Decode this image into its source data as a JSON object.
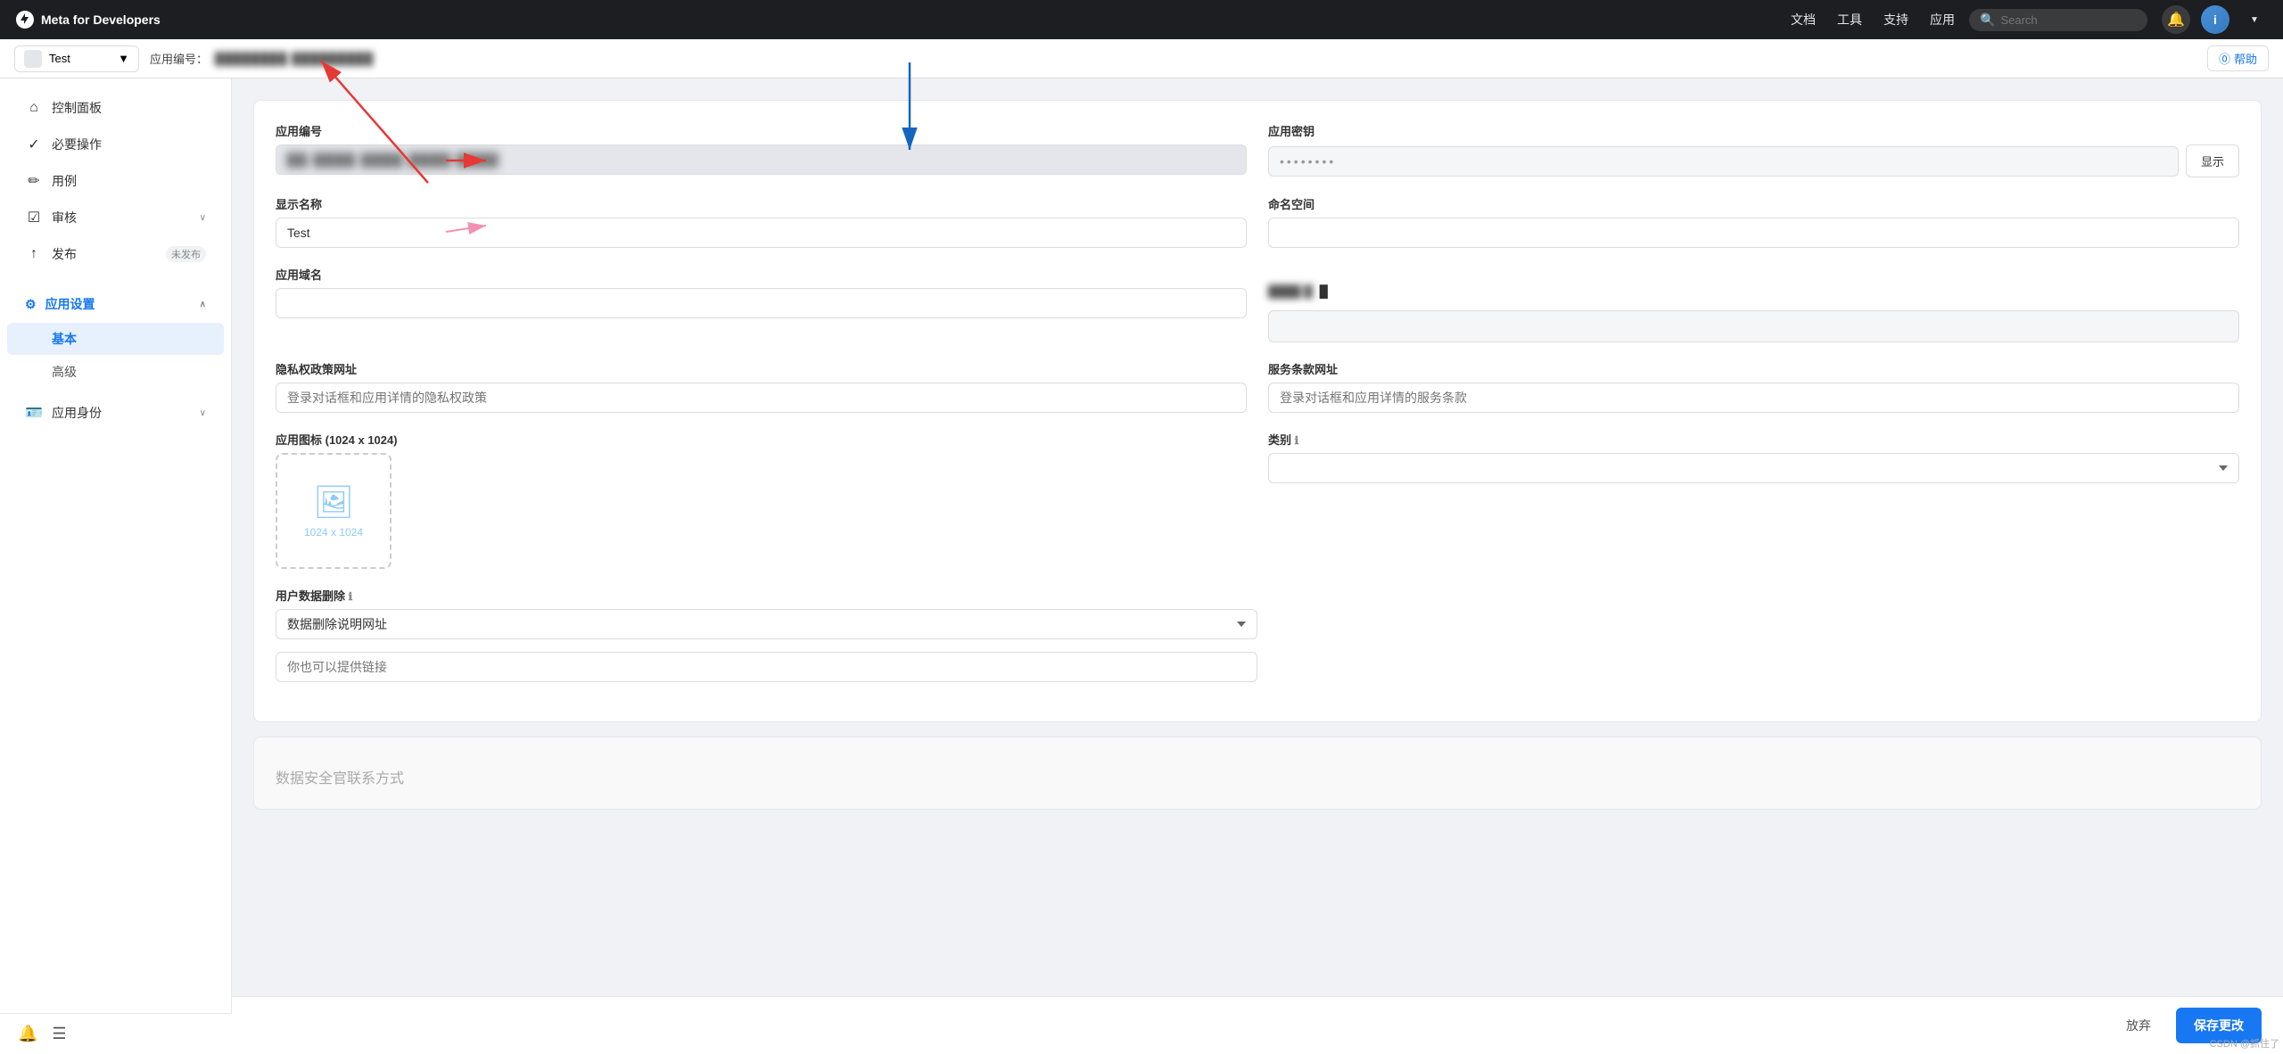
{
  "topnav": {
    "logo_text": "Meta for Developers",
    "links": [
      "文档",
      "工具",
      "支持",
      "应用"
    ],
    "search_placeholder": "Search",
    "help_label": "帮助"
  },
  "secondary_bar": {
    "app_name": "Test",
    "app_id_label": "应用编号：",
    "app_id_value": "██████ ██████",
    "help_label": "⓪ 帮助"
  },
  "sidebar": {
    "items": [
      {
        "id": "dashboard",
        "icon": "⌂",
        "label": "控制面板"
      },
      {
        "id": "required",
        "icon": "✓",
        "label": "必要操作"
      },
      {
        "id": "usecase",
        "icon": "✏",
        "label": "用例"
      },
      {
        "id": "review",
        "icon": "☑",
        "label": "审核",
        "chevron": "∨"
      },
      {
        "id": "publish",
        "icon": "↑",
        "label": "发布",
        "badge": "未发布"
      }
    ],
    "app_settings": {
      "label": "应用设置",
      "icon": "⚙",
      "sub_items": [
        {
          "id": "basic",
          "label": "基本",
          "active": true
        },
        {
          "id": "advanced",
          "label": "高级"
        }
      ]
    },
    "app_identity": {
      "label": "应用身份",
      "icon": "🪪",
      "chevron": "∨"
    },
    "footer": {
      "bell_icon": "🔔",
      "menu_icon": "☰"
    }
  },
  "form": {
    "app_id_section": {
      "label": "应用编号",
      "value_blurred": "██ ████ ████ ████"
    },
    "app_secret_section": {
      "label": "应用密钥",
      "value": "••••••••",
      "show_btn": "显示"
    },
    "display_name": {
      "label": "显示名称",
      "value": "Test"
    },
    "namespace": {
      "label": "命名空间",
      "value": ""
    },
    "app_domain": {
      "label": "应用域名",
      "value": ""
    },
    "domain_value_blurred": "████ █",
    "privacy_policy": {
      "label": "隐私权政策网址",
      "placeholder": "登录对话框和应用详情的隐私权政策"
    },
    "tos_url": {
      "label": "服务条款网址",
      "placeholder": "登录对话框和应用详情的服务条款"
    },
    "app_icon": {
      "label": "应用图标 (1024 x 1024)",
      "size_label": "1024 x 1024"
    },
    "category": {
      "label": "类别",
      "info_icon": "ℹ",
      "value": ""
    },
    "user_data_deletion": {
      "label": "用户数据删除",
      "info_icon": "ℹ",
      "dropdown_value": "数据删除说明网址",
      "link_placeholder": "你也可以提供链接"
    },
    "data_security": {
      "label": "数据安全官联系方式"
    }
  },
  "bottom_bar": {
    "discard_label": "放弃",
    "save_label": "保存更改"
  },
  "watermark": "CSDN @抓住了"
}
